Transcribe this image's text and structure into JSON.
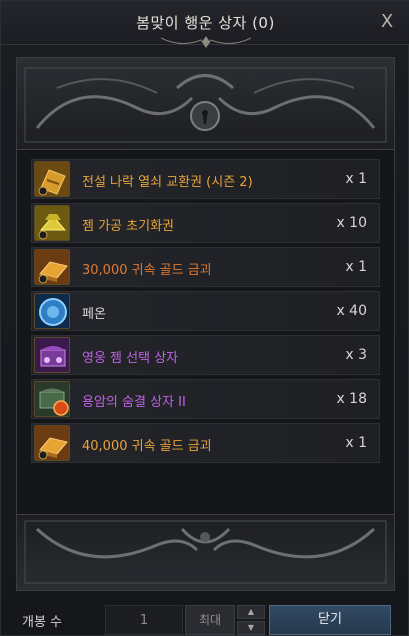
{
  "window": {
    "title": "봄맞이 행운 상자 (0)",
    "close_glyph": "X"
  },
  "items": [
    {
      "name": "전설 나락 열쇠 교환권 (시즌 2)",
      "qty": "x 1",
      "color": "#e8a33c",
      "icon": "ticket-icon"
    },
    {
      "name": "젬 가공 초기화권",
      "qty": "x 10",
      "color": "#e8a33c",
      "icon": "gem-reset-ticket-icon"
    },
    {
      "name": "30,000 귀속 골드 금괴",
      "qty": "x 1",
      "color": "#e07a32",
      "icon": "gold-bar-icon"
    },
    {
      "name": "페온",
      "qty": "x 40",
      "color": "#d8d8d8",
      "icon": "pheon-icon"
    },
    {
      "name": "영웅 젬 선택 상자",
      "qty": "x 3",
      "color": "#c061e6",
      "icon": "gem-chest-icon"
    },
    {
      "name": "용암의 숨결 상자 II",
      "qty": "x 18",
      "color": "#c061e6",
      "icon": "lava-chest-icon"
    },
    {
      "name": "40,000 귀속 골드 금괴",
      "qty": "x 1",
      "color": "#e8a33c",
      "icon": "gold-bar-icon"
    }
  ],
  "footer": {
    "open_count_label": "개봉 수",
    "count_value": "1",
    "max_label": "최대",
    "up_glyph": "▲",
    "down_glyph": "▼",
    "close_label": "닫기"
  },
  "colors": {
    "accent_blue": "#324a63",
    "legendary": "#e8a33c",
    "relic": "#e07a32",
    "epic": "#c061e6"
  }
}
